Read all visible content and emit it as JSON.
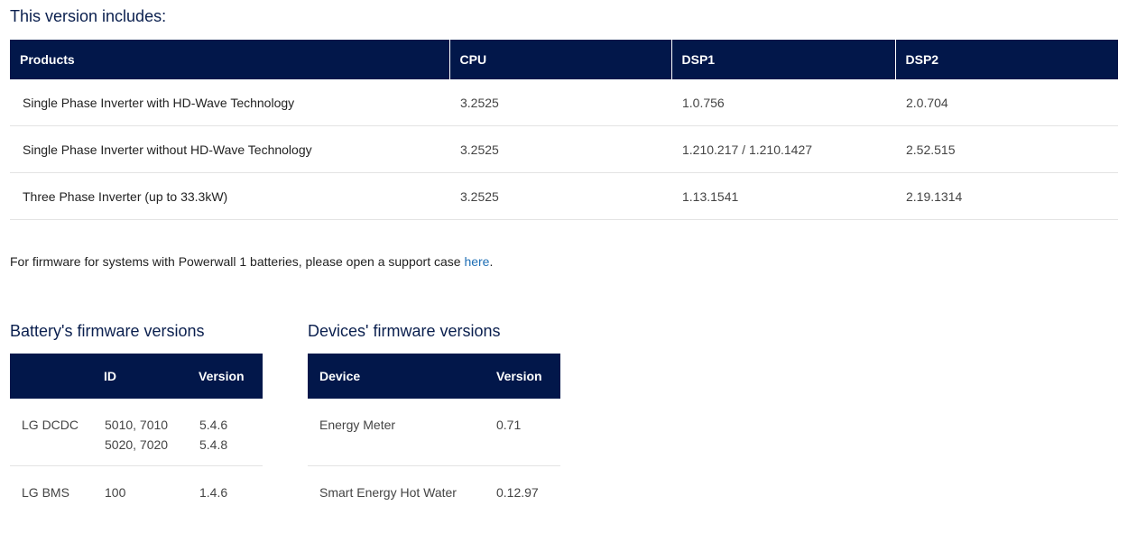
{
  "heading": "This version includes:",
  "main_table": {
    "headers": [
      "Products",
      "CPU",
      "DSP1",
      "DSP2"
    ],
    "rows": [
      [
        "Single Phase Inverter with HD-Wave Technology",
        "3.2525",
        "1.0.756",
        "2.0.704"
      ],
      [
        "Single Phase Inverter without HD-Wave Technology",
        "3.2525",
        "1.210.217 / 1.210.1427",
        "2.52.515"
      ],
      [
        "Three Phase Inverter (up to 33.3kW)",
        "3.2525",
        "1.13.1541",
        "2.19.1314"
      ]
    ]
  },
  "note": {
    "text": "For firmware for systems with Powerwall 1 batteries, please open a support case ",
    "link": "here",
    "suffix": "."
  },
  "battery": {
    "title": "Battery's firmware versions",
    "headers": [
      "",
      "ID",
      "Version"
    ],
    "rows": [
      {
        "name": "LG DCDC",
        "ids": [
          "5010, 7010",
          "5020, 7020"
        ],
        "versions": [
          "5.4.6",
          "5.4.8"
        ]
      },
      {
        "name": "LG BMS",
        "ids": [
          "100"
        ],
        "versions": [
          "1.4.6"
        ]
      }
    ]
  },
  "devices": {
    "title": "Devices' firmware versions",
    "headers": [
      "Device",
      "Version"
    ],
    "rows": [
      [
        "Energy Meter",
        "0.71"
      ],
      [
        "Smart Energy Hot Water",
        "0.12.97"
      ]
    ]
  }
}
